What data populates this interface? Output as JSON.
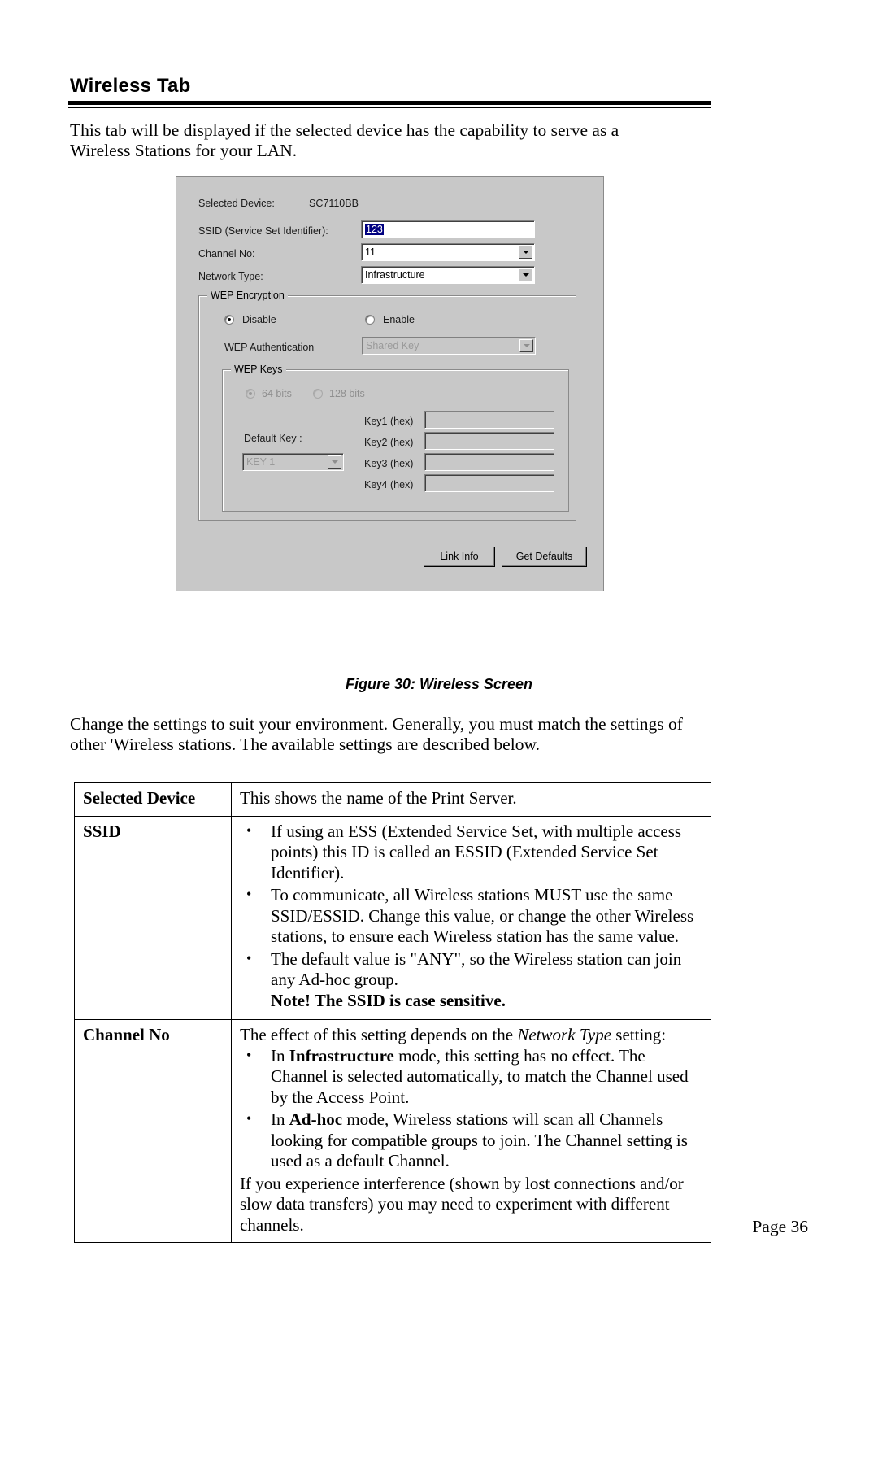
{
  "heading": "Wireless Tab",
  "intro": "This tab will be displayed if the selected device has the capability to serve as a Wireless Stations for your LAN.",
  "screenshot": {
    "selected_device_label": "Selected Device:",
    "selected_device_value": "SC7110BB",
    "ssid_label": "SSID (Service Set Identifier):",
    "ssid_value": "123",
    "channel_label": "Channel No:",
    "channel_value": "11",
    "network_type_label": "Network Type:",
    "network_type_value": "Infrastructure",
    "wep_encryption_group": "WEP Encryption",
    "disable_label": "Disable",
    "enable_label": "Enable",
    "wep_auth_label": "WEP Authentication",
    "wep_auth_value": "Shared Key",
    "wep_keys_group": "WEP Keys",
    "bits64_label": "64 bits",
    "bits128_label": "128 bits",
    "default_key_label": "Default Key :",
    "default_key_value": "KEY 1",
    "key1_label": "Key1 (hex)",
    "key2_label": "Key2 (hex)",
    "key3_label": "Key3 (hex)",
    "key4_label": "Key4 (hex)",
    "key1_value": "",
    "key2_value": "",
    "key3_value": "",
    "key4_value": "",
    "link_info_button": "Link Info",
    "get_defaults_button": "Get Defaults"
  },
  "figure_caption": "Figure 30: Wireless Screen",
  "mid_paragraph": "Change the settings to suit your environment. Generally, you must match the settings of other 'Wireless stations. The available settings are described below.",
  "table": {
    "rows": [
      {
        "key": "Selected Device",
        "text": "This shows the name of the Print Server."
      },
      {
        "key": "SSID",
        "bullets": [
          "If using an ESS (Extended Service Set, with multiple access points) this ID is called an ESSID (Extended Service Set Identifier).",
          "To communicate, all Wireless stations MUST use the same SSID/ESSID. Change this value, or change the other Wireless stations, to ensure each Wireless station has the same value.",
          "The default value is \"ANY\", so the Wireless station can join any Ad-hoc group."
        ],
        "note": "Note! The SSID is case sensitive."
      },
      {
        "key": "Channel No",
        "lead_before": "The effect of this setting depends on the ",
        "lead_italic": "Network Type",
        "lead_after": " setting:",
        "bullets": [
          {
            "before": "In ",
            "bold": "Infrastructure",
            "after": " mode, this setting has no effect. The Channel is selected automatically, to match the Channel used by the Access Point."
          },
          {
            "before": "In ",
            "bold": "Ad-hoc",
            "after": " mode, Wireless stations will scan all Channels looking for compatible groups to join. The Channel setting is used as a default Channel."
          }
        ],
        "tail": "If you experience interference (shown by lost connections and/or slow data transfers) you may need to experiment with different channels."
      }
    ]
  },
  "footer": "Page 36"
}
